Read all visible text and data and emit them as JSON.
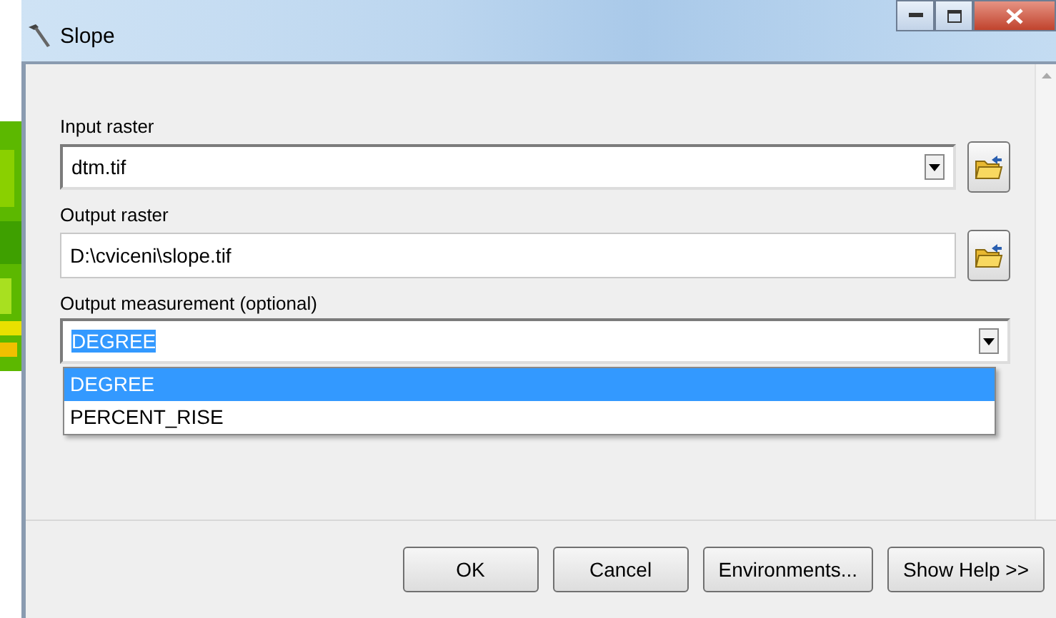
{
  "window": {
    "title": "Slope"
  },
  "fields": [
    {
      "label": "Input raster",
      "kind": "combo",
      "value": "dtm.tif",
      "browse": true,
      "expanded": false
    },
    {
      "label": "Output raster",
      "kind": "text",
      "value": "D:\\cviceni\\slope.tif",
      "browse": true,
      "expanded": false
    },
    {
      "label": "Output measurement (optional)",
      "kind": "combo",
      "value": "DEGREE",
      "browse": false,
      "expanded": true,
      "options": [
        {
          "label": "DEGREE",
          "selected": true
        },
        {
          "label": "PERCENT_RISE",
          "selected": false
        }
      ]
    }
  ],
  "buttons": [
    "OK",
    "Cancel",
    "Environments...",
    "Show Help >>"
  ]
}
